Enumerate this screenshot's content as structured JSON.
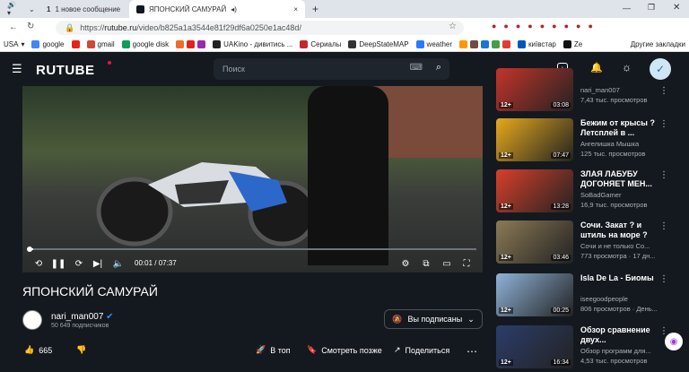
{
  "browser": {
    "tab_count": "1",
    "tab1_label": "1 новое сообщение",
    "tab2_label": "ЯПОНСКИЙ САМУРАЙ",
    "new_tab": "+",
    "url_host": "rutube.ru",
    "url_prefix": "https://",
    "url_path": "/video/b825a1a3544e81f29df6a0250e1ac48d/",
    "bookmarks": [
      "USA",
      "google",
      "gmail",
      "google disk",
      "",
      "",
      "",
      "UAKino - дивитись ...",
      "Сериалы",
      "DeepStateMAP",
      "weather",
      "",
      "",
      "",
      "",
      "",
      "",
      "",
      "київстар",
      "Ze"
    ],
    "other_bookmarks": "Другие закладки"
  },
  "header": {
    "logo": "RUTUBE",
    "search_placeholder": "Поиск"
  },
  "player": {
    "time": "00:01 / 07:37",
    "progress": 0.003
  },
  "video": {
    "title": "ЯПОНСКИЙ САМУРАЙ",
    "channel": "nari_man007",
    "subscribers": "50 649 подписчиков",
    "subscribed_label": "Вы подписаны",
    "likes": "665",
    "top_label": "В топ",
    "later_label": "Смотреть позже",
    "share_label": "Поделиться"
  },
  "sidebar": [
    {
      "title": "",
      "channel": "nari_man007",
      "meta": "7,43 тыс. просмотров",
      "age": "12+",
      "duration": "03:08",
      "color": "#c4342a"
    },
    {
      "title": "Бежим от крысы ? Летсплей в ...",
      "channel": "Ангелишка Мышка",
      "meta": "125 тыс. просмотров",
      "age": "12+",
      "duration": "07:47",
      "color": "#e7a91c"
    },
    {
      "title": "ЗЛАЯ ЛАБУБУ ДОГОНЯЕТ МЕН...",
      "channel": "SoBadGamer",
      "meta": "16,9 тыс. просмотров",
      "age": "12+",
      "duration": "13:28",
      "color": "#d7402a"
    },
    {
      "title": "Сочи. Закат ? и штиль на море ?",
      "channel": "Сочи и не только Со...",
      "meta": "773 просмотра · 17 дн...",
      "age": "12+",
      "duration": "03:46",
      "color": "#8b7a55"
    },
    {
      "title": "Isla De La - Биомы",
      "channel": "iseegoodpeople",
      "meta": "806 просмотров · День...",
      "age": "12+",
      "duration": "00:25",
      "color": "#8fb3d8"
    },
    {
      "title": "Обзор сравнение двух...",
      "channel": "Обзор программ для...",
      "meta": "4,53 тыс. просмотров",
      "age": "12+",
      "duration": "16:34",
      "color": "#2c3d6a"
    }
  ]
}
